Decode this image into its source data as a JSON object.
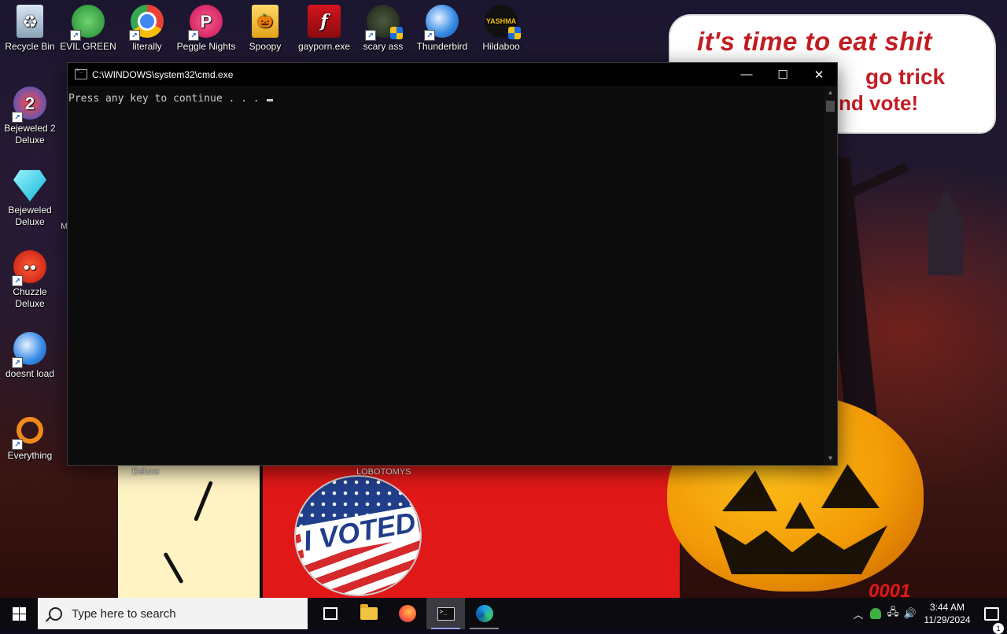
{
  "wallpaper": {
    "bubble_line1": "it's time to eat shit",
    "bubble_line2": "go trick",
    "bubble_line2_prefix": "d",
    "bubble_line3": "nd vote!",
    "badge_text": "I VOTED",
    "corner_number": "0001"
  },
  "desktop_icons": [
    {
      "label": "Recycle Bin",
      "icon": "recycle-bin-icon"
    },
    {
      "label": "EVIL GREEN MEN CO",
      "icon": "messenger-people-icon"
    },
    {
      "label": "literally",
      "icon": "chrome-icon"
    },
    {
      "label": "Peggle Nights",
      "icon": "peggle-icon"
    },
    {
      "label": "Spoopy",
      "icon": "folder-spoopy-icon"
    },
    {
      "label": "gayporn.exe",
      "icon": "flash-icon"
    },
    {
      "label": "scary ass",
      "icon": "scary-ass-icon"
    },
    {
      "label": "Thunderbird",
      "icon": "thunderbird-icon"
    },
    {
      "label": "Hildaboo",
      "icon": "hildaboo-icon"
    },
    {
      "label": "Bejeweled 2 Deluxe",
      "icon": "bejeweled-2-icon"
    },
    {
      "label": "Bejeweled Deluxe",
      "icon": "bejeweled-diamond-icon"
    },
    {
      "label": "Chuzzle Deluxe",
      "icon": "chuzzle-icon"
    },
    {
      "label": "doesnt load",
      "icon": "thunderbird-icon"
    },
    {
      "label": "Everything",
      "icon": "everything-search-icon"
    }
  ],
  "hidden_labels": {
    "deluxe": "Deluxe",
    "lobotomys": "LOBOTOMYS",
    "m_fragment": "M"
  },
  "cmd": {
    "title": "C:\\WINDOWS\\system32\\cmd.exe",
    "output": "Press any key to continue . . . ",
    "minimize": "—",
    "maximize": "☐",
    "close": "✕"
  },
  "taskbar": {
    "search_placeholder": "Type here to search",
    "pinned": [
      "task-view",
      "file-explorer",
      "firefox",
      "cmd",
      "edge"
    ],
    "time": "3:44 AM",
    "date": "11/29/2024",
    "notification_count": "1"
  },
  "colors": {
    "bubble_text": "#c21d23",
    "cmd_background": "#0c0c0c",
    "taskbar": "#0b0b10",
    "search_box": "#f3f3f3"
  }
}
